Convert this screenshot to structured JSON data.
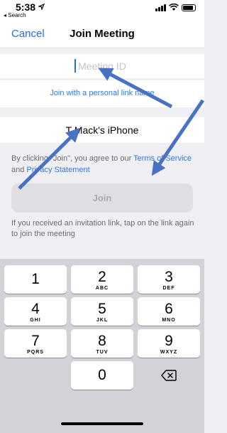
{
  "status_bar": {
    "time": "5:38",
    "back_label": "◂ Search"
  },
  "nav": {
    "cancel_label": "Cancel",
    "title": "Join Meeting"
  },
  "meeting_id": {
    "value": "",
    "placeholder": "Meeting ID"
  },
  "personal_link": {
    "label": "Join with a personal link name"
  },
  "display_name": {
    "value": "T Mack's iPhone"
  },
  "terms": {
    "prefix": "By clicking \"Join\", you agree to our ",
    "terms_link": "Terms of Service",
    "middle": " and ",
    "privacy_link": "Privacy Statement"
  },
  "join_button": {
    "label": "Join"
  },
  "invite_text": "If you received an invitation link, tap on the link again to join the meeting",
  "keyboard": {
    "keys": [
      {
        "num": "1",
        "letters": ""
      },
      {
        "num": "2",
        "letters": "ABC"
      },
      {
        "num": "3",
        "letters": "DEF"
      },
      {
        "num": "4",
        "letters": "GHI"
      },
      {
        "num": "5",
        "letters": "JKL"
      },
      {
        "num": "6",
        "letters": "MNO"
      },
      {
        "num": "7",
        "letters": "PQRS"
      },
      {
        "num": "8",
        "letters": "TUV"
      },
      {
        "num": "9",
        "letters": "WXYZ"
      },
      {
        "num": "0",
        "letters": ""
      }
    ],
    "delete_icon": "backspace-icon"
  },
  "colors": {
    "accent": "#2d7be0",
    "annotation_arrow": "#4a72c4"
  }
}
